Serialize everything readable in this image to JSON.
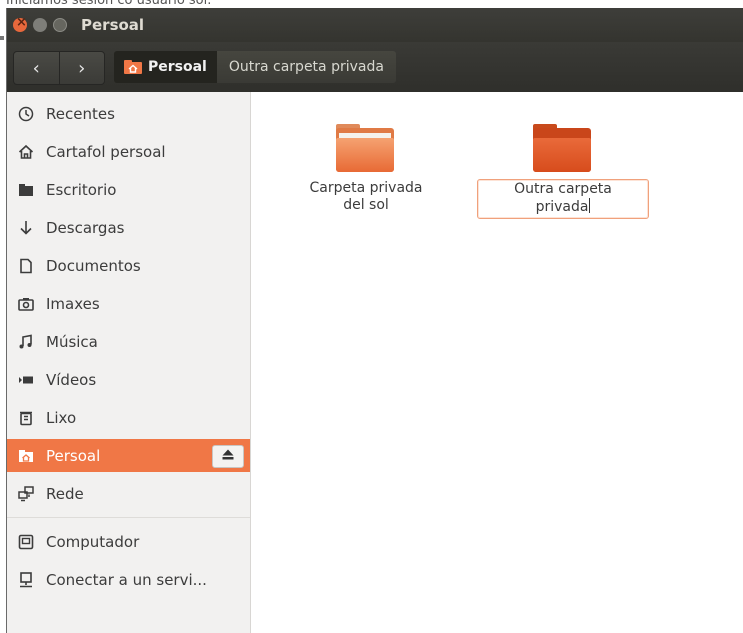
{
  "caption": "Iniciamos sesión co usuario sol.",
  "window": {
    "title": "Persoal"
  },
  "toolbar": {
    "back_glyph": "‹",
    "forward_glyph": "›",
    "breadcrumbs": [
      "Persoal",
      "Outra carpeta privada"
    ]
  },
  "sidebar": {
    "items": [
      {
        "label": "Recentes",
        "icon": "clock-icon"
      },
      {
        "label": "Cartafol persoal",
        "icon": "home-icon"
      },
      {
        "label": "Escritorio",
        "icon": "folder-icon"
      },
      {
        "label": "Descargas",
        "icon": "download-icon"
      },
      {
        "label": "Documentos",
        "icon": "document-icon"
      },
      {
        "label": "Imaxes",
        "icon": "camera-icon"
      },
      {
        "label": "Música",
        "icon": "music-icon"
      },
      {
        "label": "Vídeos",
        "icon": "video-icon"
      },
      {
        "label": "Lixo",
        "icon": "trash-icon"
      },
      {
        "label": "Persoal",
        "icon": "home-folder-icon",
        "active": true
      },
      {
        "label": "Rede",
        "icon": "network-icon"
      },
      {
        "label": "Computador",
        "icon": "computer-icon"
      },
      {
        "label": "Conectar a un servi...",
        "icon": "connect-server-icon"
      }
    ],
    "accent": "#f07746"
  },
  "content": {
    "folders": [
      {
        "label_line1": "Carpeta privada",
        "label_line2": "del sol",
        "state": "normal"
      },
      {
        "label_line1": "Outra carpeta",
        "label_line2": "privada",
        "state": "renaming"
      }
    ]
  }
}
